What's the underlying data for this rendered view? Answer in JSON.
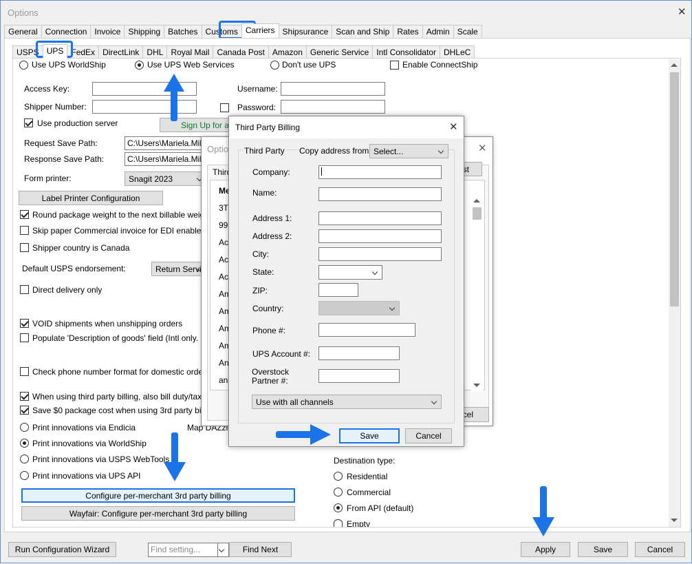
{
  "window": {
    "title": "Options"
  },
  "main_tabs": [
    "General",
    "Connection",
    "Invoice",
    "Shipping",
    "Batches",
    "Customs",
    "Carriers",
    "Shipsurance",
    "Scan and Ship",
    "Rates",
    "Admin",
    "Scale"
  ],
  "carrier_tabs": [
    "USPS",
    "UPS",
    "FedEx",
    "DirectLink",
    "DHL",
    "Royal Mail",
    "Canada Post",
    "Amazon",
    "Generic Service",
    "Intl Consolidator",
    "DHLeC"
  ],
  "ups": {
    "mode_worldship": "Use UPS WorldShip",
    "mode_web": "Use UPS Web Services",
    "mode_none": "Don't use UPS",
    "enable_connectship": "Enable ConnectShip",
    "access_key_label": "Access Key:",
    "username_label": "Username:",
    "shipper_number_label": "Shipper Number:",
    "password_label": "Password:",
    "use_production": "Use production server",
    "signup": "Sign Up for a U",
    "request_path_label": "Request Save Path:",
    "request_path": "C:\\Users\\Mariela.Milch",
    "response_path_label": "Response Save Path:",
    "response_path": "C:\\Users\\Mariela.Milch",
    "form_printer_label": "Form printer:",
    "form_printer": "Snagit 2023",
    "label_printer_btn": "Label Printer Configuration",
    "round_weight": "Round package weight to the next billable weight",
    "skip_paper": "Skip paper Commercial invoice for EDI enabled acco",
    "shipper_canada": "Shipper country is Canada",
    "default_usps_label": "Default USPS endorsement:",
    "default_usps": "Return Service",
    "direct_delivery": "Direct delivery only",
    "void_shipments": "VOID shipments when unshipping orders",
    "populate_desc": "Populate 'Description of goods' field (Intl only. Domes",
    "check_phone": "Check phone number format for domestic orders",
    "third_party_duty": "When using third party billing, also bill duty/taxes to t",
    "save_zero": "Save $0 package cost when using 3rd party billing",
    "print_endicia": "Print innovations via Endicia",
    "print_worldship": "Print innovations via WorldShip",
    "print_webtools": "Print innovations via USPS WebTools",
    "print_upsapi": "Print innovations via UPS API",
    "map_dazzle": "Map DAZzle",
    "configure_3rd": "Configure per-merchant 3rd party billing",
    "wayfair_3rd": "Wayfair: Configure per-merchant 3rd party billing",
    "dest_type_label": "Destination type:",
    "dest_residential": "Residential",
    "dest_commercial": "Commercial",
    "dest_api": "From API (default)",
    "dest_empty": "Empty"
  },
  "back_dialog": {
    "title": "Option",
    "tab": "Third",
    "list_btn": "list",
    "cancel_btn": "cel",
    "rows": [
      "Me",
      "3Ti",
      "999",
      "Ace",
      "Ace",
      "Ace",
      "Am",
      "Am",
      "Ami",
      "Amy",
      "Ang",
      "and",
      "Ari"
    ]
  },
  "third_party": {
    "title": "Third Party Billing",
    "group": "Third Party",
    "copy_from_label": "Copy address from:",
    "copy_from": "Select...",
    "company_label": "Company:",
    "name_label": "Name:",
    "address1_label": "Address 1:",
    "address2_label": "Address 2:",
    "city_label": "City:",
    "state_label": "State:",
    "zip_label": "ZIP:",
    "country_label": "Country:",
    "phone_label": "Phone #:",
    "account_label": "UPS Account #:",
    "overstock_label": "Overstock Partner #:",
    "channels": "Use with all channels",
    "save": "Save",
    "cancel": "Cancel"
  },
  "footer": {
    "wizard": "Run Configuration Wizard",
    "find_placeholder": "Find setting...",
    "find_next": "Find Next",
    "apply": "Apply",
    "save": "Save",
    "cancel": "Cancel"
  },
  "colors": {
    "accent": "#1a73e8",
    "signup_green": "#0a7a2a"
  }
}
